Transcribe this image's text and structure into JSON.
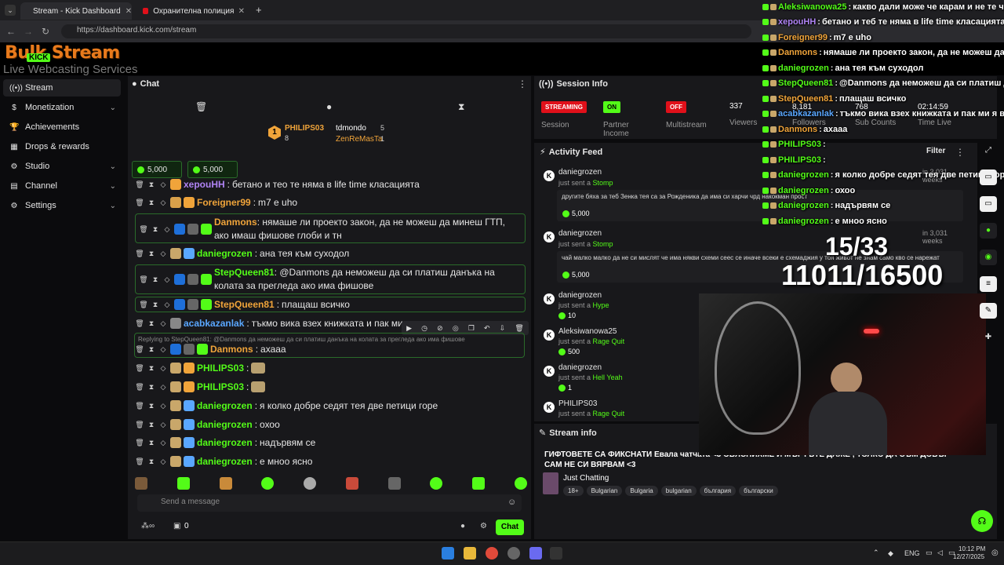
{
  "browser": {
    "tabs": [
      {
        "title": "Stream - Kick Dashboard",
        "close": "✕"
      },
      {
        "title": "Охранителна полиция 8 РУ | П",
        "close": "✕"
      }
    ],
    "new_tab": "+",
    "url": "https://dashboard.kick.com/stream"
  },
  "logo": {
    "main": "Bulk Stream",
    "kick": "KICK",
    "sub": "Live Webcasting Services"
  },
  "sidebar": {
    "items": [
      {
        "label": "Stream",
        "icon": "stream-icon",
        "active": true
      },
      {
        "label": "Monetization",
        "icon": "dollar-icon",
        "chevron": true
      },
      {
        "label": "Achievements",
        "icon": "trophy-icon"
      },
      {
        "label": "Drops & rewards",
        "icon": "gift-icon"
      },
      {
        "label": "Studio",
        "icon": "studio-icon",
        "chevron": true
      },
      {
        "label": "Channel",
        "icon": "channel-icon",
        "chevron": true
      },
      {
        "label": "Settings",
        "icon": "gear-icon",
        "chevron": true
      }
    ]
  },
  "chat": {
    "title": "Chat",
    "leaderboard": {
      "first": {
        "rank": "1",
        "user": "PHILIPS03",
        "count": "8"
      },
      "second": {
        "user": "tdmondo",
        "count": "5"
      },
      "third": {
        "user": "ZenReMasTa",
        "count": "1"
      }
    },
    "pinned_gifts": [
      "5,000",
      "5,000"
    ],
    "messages": [
      {
        "user": "xepouHH",
        "color": "p",
        "text": "бетано и тео те няма в life time класацията"
      },
      {
        "user": "Foreigner99",
        "color": "o",
        "text": "m7 е uho"
      },
      {
        "user": "Danmons",
        "color": "o",
        "text": "нямаше ли проекто закон, да не можеш да минеш ГТП, ако имаш фишове глоби и тн"
      },
      {
        "user": "daniegrozen",
        "color": "g",
        "text": "ана тея към суходол"
      },
      {
        "user": "StepQueen81",
        "color": "g",
        "text": "@Danmons да неможеш да си платиш данъка на колата за прегледа ако има фишове"
      },
      {
        "user": "StepQueen81",
        "color": "o",
        "text": "плащаш всичко"
      },
      {
        "user": "acabkazanlak",
        "color": "b",
        "text": "тъкмо вика взех книжката и пак ми"
      },
      {
        "reply": "Replying to StepQueen81: @Danmons да неможеш да си платиш данъка на колата за прегледа ако има фишове",
        "user": "Danmons",
        "color": "o",
        "text": "ахааа"
      },
      {
        "user": "PHILIPS03",
        "color": "g",
        "text": ""
      },
      {
        "user": "PHILIPS03",
        "color": "g",
        "text": ""
      },
      {
        "user": "daniegrozen",
        "color": "g",
        "text": "я колко добре седят тея две петици горе"
      },
      {
        "user": "daniegrozen",
        "color": "g",
        "text": "охоо"
      },
      {
        "user": "daniegrozen",
        "color": "g",
        "text": "надървям се"
      },
      {
        "user": "daniegrozen",
        "color": "g",
        "text": "е мноо ясно"
      }
    ],
    "input_placeholder": "Send a message",
    "viewer_count": "0",
    "chat_button": "Chat"
  },
  "session": {
    "title": "Session Info",
    "stats": [
      {
        "badge": "STREAMING",
        "label": "Session",
        "color": "#e0101a"
      },
      {
        "badge": "ON",
        "label": "Partner Income",
        "color": "#53fc18"
      },
      {
        "badge": "OFF",
        "label": "Multistream",
        "color": "#e0101a"
      },
      {
        "value": "337",
        "label": "Viewers"
      },
      {
        "value": "8,181",
        "label": "Followers"
      },
      {
        "value": "768",
        "label": "Sub Counts"
      },
      {
        "value": "02:14:59",
        "label": "Time Live"
      }
    ]
  },
  "activity": {
    "title": "Activity Feed",
    "filter": "Filter",
    "items": [
      {
        "user": "daniegrozen",
        "action": "just sent a",
        "item": "Stomp",
        "note": "другите бяха за теб Зенка тея са за Рожденика да има си харчи чрд накокман прост",
        "amount": "5,000",
        "when": "in 3,031 weeks"
      },
      {
        "user": "daniegrozen",
        "action": "just sent a",
        "item": "Stomp",
        "note": "чай малко малко да не си мислят че има някви схеми сеес се иначе всеки е схемаджия у тоя живот не знам само кво се нарежат",
        "amount": "5,000",
        "when": "in 3,031 weeks"
      },
      {
        "user": "daniegrozen",
        "action": "just sent a",
        "item": "Hype",
        "amount": "10"
      },
      {
        "user": "Aleksiwanowa25",
        "action": "just sent a",
        "item": "Rage Quit",
        "amount": "500"
      },
      {
        "user": "daniegrozen",
        "action": "just sent a",
        "item": "Hell Yeah",
        "amount": "1"
      },
      {
        "user": "PHILIPS03",
        "action": "just sent a",
        "item": "Rage Quit"
      }
    ]
  },
  "stream_info": {
    "title": "Stream info",
    "stream_title": "ГИФТОВЕТЕ СА ФИКСНАТИ Евала чатчата <3 ОБЯСНИХМЕ И МЪРТЪТЕ ДАЖЕ , ТОЛКО ДА СЪМ ДОБЪР САМ НЕ СИ ВЯРВАМ <3",
    "category": "Just Chatting",
    "tags": [
      "18+",
      "Bulgarian",
      "Bulgaria",
      "bulgarian",
      "българия",
      "български"
    ]
  },
  "overlay": {
    "messages": [
      {
        "user": "Aleksiwanowa25",
        "color": "#53fc18",
        "text": "какво дали може че карам и не те чух"
      },
      {
        "user": "xepouHH",
        "color": "#b084f5",
        "text": "бетано и теб те няма в life time класацията"
      },
      {
        "user": "Foreigner99",
        "color": "#f0a43a",
        "text": "m7 е uho"
      },
      {
        "user": "Danmons",
        "color": "#f0a43a",
        "text": "нямаше ли проекто закон, да не можеш да ми"
      },
      {
        "user": "daniegrozen",
        "color": "#53fc18",
        "text": "ана тея към суходол"
      },
      {
        "user": "StepQueen81",
        "color": "#53fc18",
        "text": "@Danmons да неможеш да си платиш да"
      },
      {
        "user": "StepQueen81",
        "color": "#f0a43a",
        "text": "плащаш всичко"
      },
      {
        "user": "acabkazanlak",
        "color": "#5aa7ff",
        "text": "тъкмо вика взех книжката и пак ми я вжеха"
      },
      {
        "user": "Danmons",
        "color": "#f0a43a",
        "text": "ахааа"
      },
      {
        "user": "PHILIPS03",
        "color": "#53fc18",
        "text": ""
      },
      {
        "user": "PHILIPS03",
        "color": "#53fc18",
        "text": ""
      },
      {
        "user": "daniegrozen",
        "color": "#53fc18",
        "text": "я колко добре седят тея две петици горе"
      },
      {
        "user": "daniegrozen",
        "color": "#53fc18",
        "text": "охоо"
      },
      {
        "user": "daniegrozen",
        "color": "#53fc18",
        "text": "надървям се"
      },
      {
        "user": "daniegrozen",
        "color": "#53fc18",
        "text": "е мноо ясно"
      }
    ],
    "counter_top": "15/33",
    "counter_bottom": "11011/16500"
  },
  "taskbar": {
    "lang": "ENG",
    "time": "10:12 PM",
    "date": "12/27/2025"
  }
}
